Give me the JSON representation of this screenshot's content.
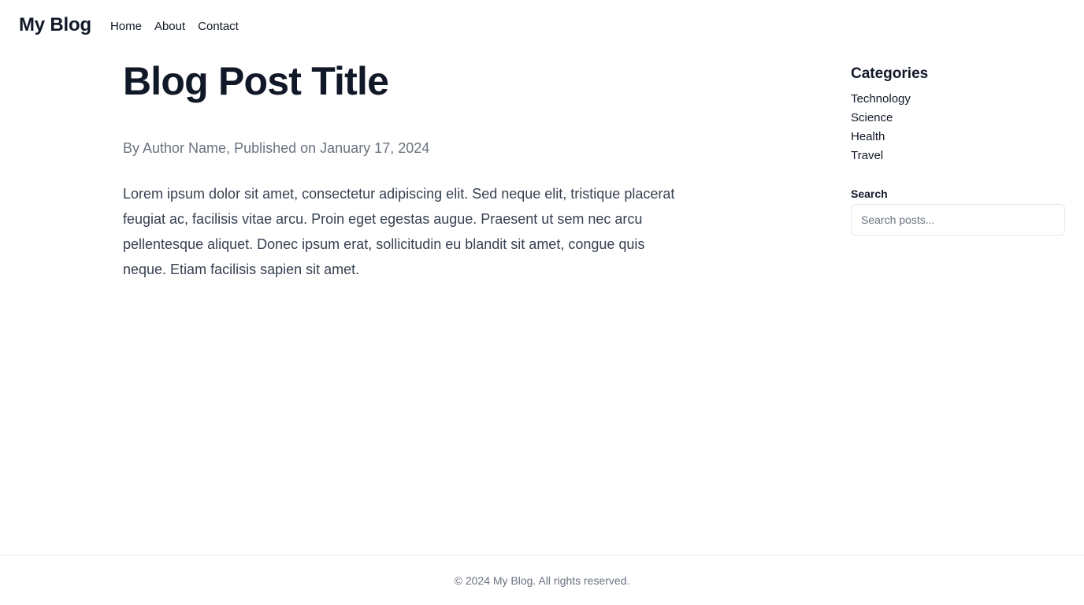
{
  "header": {
    "brand": "My Blog",
    "nav": [
      {
        "label": "Home"
      },
      {
        "label": "About"
      },
      {
        "label": "Contact"
      }
    ]
  },
  "post": {
    "title": "Blog Post Title",
    "meta": "By Author Name, Published on January 17, 2024",
    "body": "Lorem ipsum dolor sit amet, consectetur adipiscing elit. Sed neque elit, tristique placerat feugiat ac, facilisis vitae arcu. Proin eget egestas augue. Praesent ut sem nec arcu pellentesque aliquet. Donec ipsum erat, sollicitudin eu blandit sit amet, congue quis neque. Etiam facilisis sapien sit amet."
  },
  "sidebar": {
    "categories_heading": "Categories",
    "categories": [
      {
        "label": "Technology"
      },
      {
        "label": "Science"
      },
      {
        "label": "Health"
      },
      {
        "label": "Travel"
      }
    ],
    "search_label": "Search",
    "search_placeholder": "Search posts...",
    "search_value": ""
  },
  "footer": {
    "text": "© 2024 My Blog. All rights reserved."
  },
  "colors": {
    "text_primary": "#111827",
    "text_muted": "#6b7280",
    "text_body": "#374151",
    "border": "#e5e7eb",
    "background": "#ffffff"
  }
}
